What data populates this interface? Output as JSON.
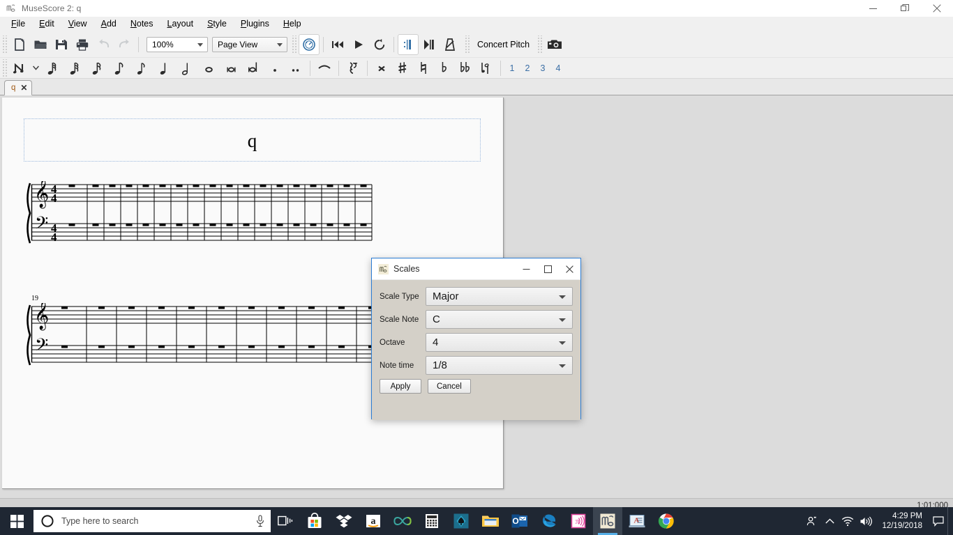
{
  "window": {
    "title": "MuseScore 2: q",
    "app_icon": "musescore-icon",
    "minimize_label": "Minimize",
    "restore_label": "Restore",
    "close_label": "Close"
  },
  "menubar": {
    "items": [
      {
        "label": "File",
        "mnemonic": "F"
      },
      {
        "label": "Edit",
        "mnemonic": "E"
      },
      {
        "label": "View",
        "mnemonic": "V"
      },
      {
        "label": "Add",
        "mnemonic": "A"
      },
      {
        "label": "Notes",
        "mnemonic": "N"
      },
      {
        "label": "Layout",
        "mnemonic": "L"
      },
      {
        "label": "Style",
        "mnemonic": "S"
      },
      {
        "label": "Plugins",
        "mnemonic": "P"
      },
      {
        "label": "Help",
        "mnemonic": "H"
      }
    ]
  },
  "toolbar_main": {
    "new_label": "New",
    "open_label": "Open",
    "save_label": "Save",
    "print_label": "Print",
    "undo_label": "Undo",
    "redo_label": "Redo",
    "zoom_value": "100%",
    "view_value": "Page View",
    "play_panel_label": "Play Panel",
    "rewind_label": "Rewind",
    "play_label": "Play",
    "loop_label": "Loop Playback",
    "play_repeats_label": "Play Repeats",
    "pan_score_label": "Pan Score",
    "metronome_label": "Metronome",
    "concert_pitch_label": "Concert Pitch",
    "image_capture_label": "Image Capture"
  },
  "toolbar_note_input": {
    "note_input_label": "Note Input",
    "durations": [
      {
        "name": "64th-note",
        "glyph": "𝅘𝅥𝅰"
      },
      {
        "name": "32nd-note",
        "glyph": "𝅘𝅥𝅯"
      },
      {
        "name": "16th-note",
        "glyph": "𝅘𝅥𝅯"
      },
      {
        "name": "eighth-note",
        "glyph": "𝅘𝅥𝅮"
      },
      {
        "name": "eighth-note-alt",
        "glyph": "♪"
      },
      {
        "name": "quarter-note",
        "glyph": "♩"
      },
      {
        "name": "half-note",
        "glyph": "𝅗𝅥"
      },
      {
        "name": "whole-note",
        "glyph": "𝅝"
      },
      {
        "name": "breve-note",
        "glyph": "𝅜"
      },
      {
        "name": "longa-note",
        "glyph": "𝅛"
      }
    ],
    "dot_label": "Augmentation Dot",
    "double_dot_label": "Double Augmentation Dot",
    "tie_label": "Tie",
    "rest_label": "Rest",
    "accidentals": [
      {
        "name": "double-sharp",
        "glyph": "𝄪"
      },
      {
        "name": "sharp",
        "glyph": "♯"
      },
      {
        "name": "natural",
        "glyph": "♮"
      },
      {
        "name": "flat",
        "glyph": "♭"
      },
      {
        "name": "double-flat",
        "glyph": "𝄫"
      },
      {
        "name": "flip-direction",
        "glyph": "𝅥"
      }
    ],
    "voices": [
      "1",
      "2",
      "3",
      "4"
    ]
  },
  "tabs": {
    "items": [
      {
        "label": "q",
        "close_label": "✕"
      }
    ]
  },
  "score": {
    "title": "q",
    "system1": {
      "measure_number": "",
      "clef_top": "treble",
      "clef_bottom": "bass",
      "time_signature": "4/4",
      "measures": 18,
      "rest_symbol": "whole-measure-rest"
    },
    "system2": {
      "measure_number": "19",
      "clef_top": "treble",
      "clef_bottom": "bass",
      "measures": 14,
      "rest_symbol": "whole-measure-rest",
      "final_barline": "end-barline"
    }
  },
  "statusbar": {
    "position": "1:01:000"
  },
  "dialog": {
    "title": "Scales",
    "icon": "musescore-icon",
    "minimize_label": "Minimize",
    "maximize_label": "Maximize",
    "close_label": "Close",
    "fields": [
      {
        "label": "Scale Type",
        "value": "Major"
      },
      {
        "label": "Scale Note",
        "value": "C"
      },
      {
        "label": "Octave",
        "value": "4"
      },
      {
        "label": "Note time",
        "value": "1/8"
      }
    ],
    "apply_label": "Apply",
    "cancel_label": "Cancel"
  },
  "taskbar": {
    "start_label": "Start",
    "search_placeholder": "Type here to search",
    "cortana_label": "Cortana",
    "microphone_label": "Microphone",
    "items": [
      {
        "name": "task-view-icon",
        "label": "Task View"
      },
      {
        "name": "microsoft-store-icon",
        "label": "Microsoft Store"
      },
      {
        "name": "dropbox-icon",
        "label": "Dropbox"
      },
      {
        "name": "amazon-icon",
        "label": "Amazon"
      },
      {
        "name": "infinity-icon",
        "label": "Infinity"
      },
      {
        "name": "calculator-icon",
        "label": "Calculator"
      },
      {
        "name": "solitaire-icon",
        "label": "Solitaire"
      },
      {
        "name": "file-explorer-icon",
        "label": "File Explorer"
      },
      {
        "name": "outlook-icon",
        "label": "Outlook"
      },
      {
        "name": "edge-icon",
        "label": "Microsoft Edge"
      },
      {
        "name": "wireless-app-icon",
        "label": "Wireless"
      },
      {
        "name": "musescore-taskbar-icon",
        "label": "MuseScore 2"
      },
      {
        "name": "document-app-icon",
        "label": "Document"
      },
      {
        "name": "chrome-icon",
        "label": "Google Chrome"
      }
    ],
    "tray": {
      "people_label": "People",
      "show_hidden_label": "Show hidden icons",
      "network_label": "Network",
      "volume_label": "Volume",
      "time": "4:29 PM",
      "date": "12/19/2018",
      "action_center_label": "Action Center"
    }
  },
  "colors": {
    "accent": "#2b7cd3",
    "taskbar_bg": "#1f2733",
    "toolbar_bg": "#f0f0f0",
    "canvas_bg": "#dcdcdc",
    "page_bg": "#fafafa",
    "voice_blue": "#3a6ea5"
  }
}
